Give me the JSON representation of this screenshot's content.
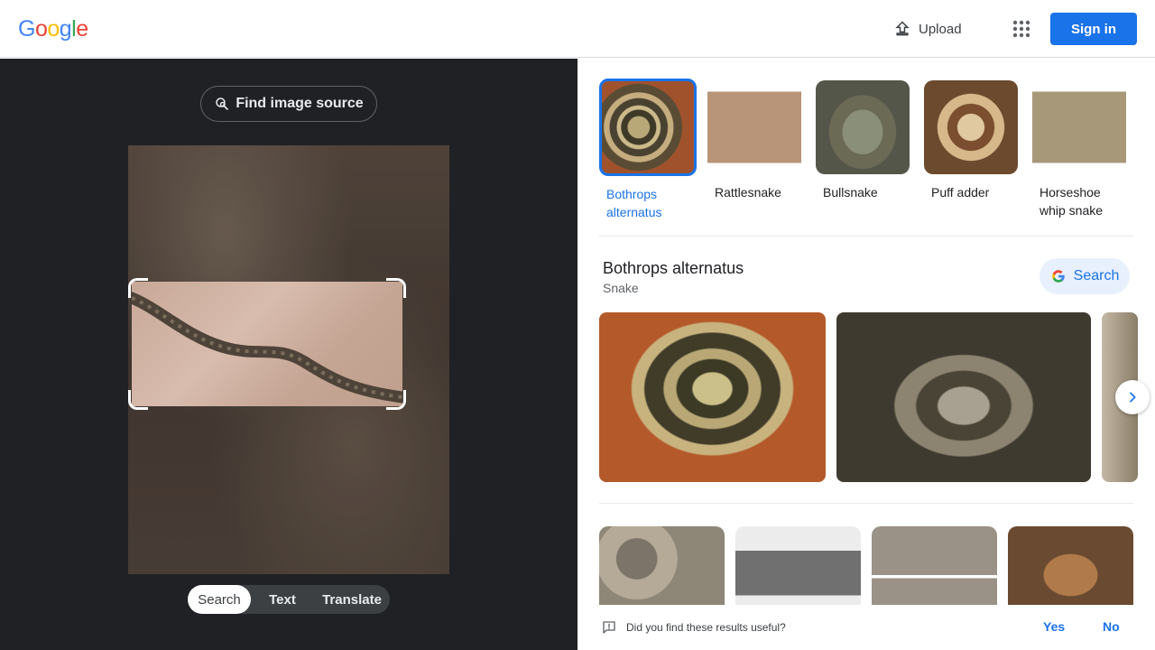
{
  "header": {
    "logo_letters": [
      "G",
      "o",
      "o",
      "g",
      "l",
      "e"
    ],
    "upload_label": "Upload",
    "apps_icon": "apps-grid-icon",
    "signin_label": "Sign in",
    "brand_color": "#1a73e8"
  },
  "lens": {
    "find_source_label": "Find image source",
    "modes": [
      {
        "label": "Search",
        "active": true
      },
      {
        "label": "Text",
        "active": false
      },
      {
        "label": "Translate",
        "active": false
      }
    ]
  },
  "matches": [
    {
      "label": "Bothrops alternatus",
      "selected": true
    },
    {
      "label": "Rattlesnake",
      "selected": false
    },
    {
      "label": "Bullsnake",
      "selected": false
    },
    {
      "label": "Puff adder",
      "selected": false
    },
    {
      "label": "Horseshoe whip snake",
      "selected": false
    }
  ],
  "entity": {
    "title": "Bothrops alternatus",
    "subtitle": "Snake",
    "search_label": "Search"
  },
  "feedback": {
    "question": "Did you find these results useful?",
    "yes": "Yes",
    "no": "No"
  }
}
